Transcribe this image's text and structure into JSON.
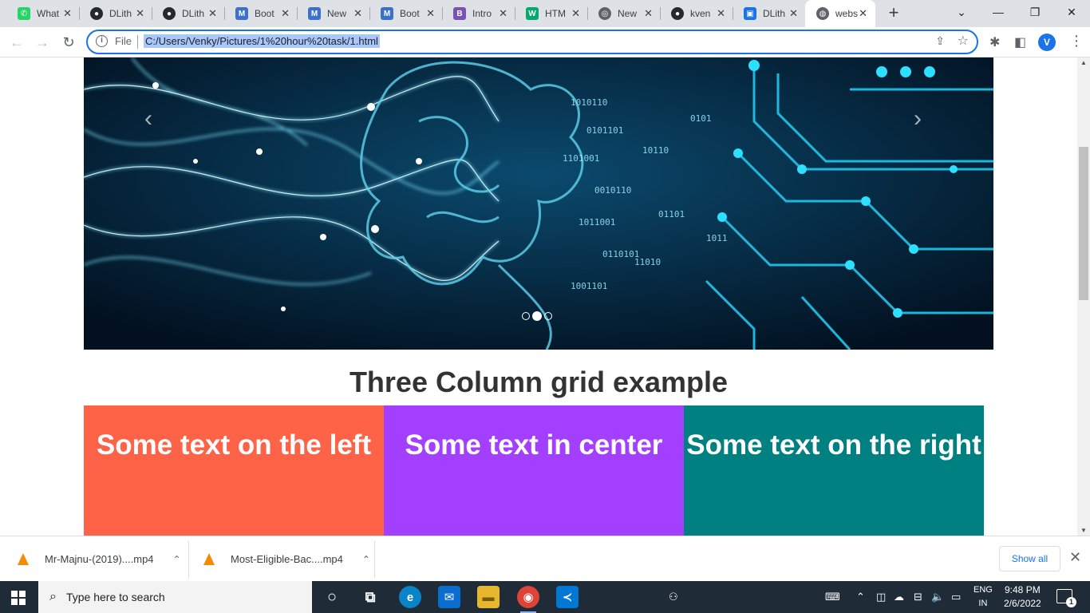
{
  "browser": {
    "tabs": [
      {
        "title": "What",
        "icon": "whatsapp-icon",
        "color": "#25d366",
        "glyph": "✆"
      },
      {
        "title": "DLith",
        "icon": "github-icon",
        "color": "#24292e",
        "glyph": "●"
      },
      {
        "title": "DLith",
        "icon": "github-icon",
        "color": "#24292e",
        "glyph": "●"
      },
      {
        "title": "Boot",
        "icon": "mdb-icon",
        "color": "#3b71ca",
        "glyph": "M"
      },
      {
        "title": "New",
        "icon": "mdb-icon",
        "color": "#3b71ca",
        "glyph": "M"
      },
      {
        "title": "Boot",
        "icon": "mdb-icon",
        "color": "#3b71ca",
        "glyph": "M"
      },
      {
        "title": "Intro",
        "icon": "bootstrap-icon",
        "color": "#7952b3",
        "glyph": "B"
      },
      {
        "title": "HTM",
        "icon": "w3schools-icon",
        "color": "#04aa6d",
        "glyph": "W"
      },
      {
        "title": "New",
        "icon": "chrome-icon",
        "color": "#5f6368",
        "glyph": "◎"
      },
      {
        "title": "kven",
        "icon": "github-icon",
        "color": "#24292e",
        "glyph": "●"
      },
      {
        "title": "DLith",
        "icon": "contacts-icon",
        "color": "#1a73e8",
        "glyph": "▣"
      },
      {
        "title": "webs",
        "icon": "globe-icon",
        "color": "#5f6368",
        "glyph": "◍"
      }
    ],
    "close_glyph": "✕",
    "new_tab_glyph": "+",
    "tab_search_glyph": "⌄",
    "minimize_glyph": "—",
    "restore_glyph": "❐",
    "window_close_glyph": "✕",
    "back_glyph": "←",
    "forward_glyph": "→",
    "reload_glyph": "↻",
    "info_glyph": "i",
    "scheme_label": "File",
    "url": "C:/Users/Venky/Pictures/1%20hour%20task/1.html",
    "share_glyph": "⇪",
    "star_glyph": "☆",
    "extensions_glyph": "✱",
    "sidepanel_glyph": "◧",
    "profile_initial": "V",
    "menu_glyph": "⋮"
  },
  "page": {
    "carousel": {
      "prev_glyph": "‹",
      "next_glyph": "›",
      "indicator_count": 3,
      "active_index": 1
    },
    "heading": "Three Column grid example",
    "columns": [
      {
        "text": "Some text on the left",
        "color": "#ff6347"
      },
      {
        "text": "Some text in center",
        "color": "#a340ff"
      },
      {
        "text": "Some text on the right",
        "color": "#008080"
      }
    ]
  },
  "scrollbar": {
    "up_glyph": "▲",
    "down_glyph": "▼"
  },
  "downloads": {
    "items": [
      {
        "name": "Mr-Majnu-(2019)....mp4",
        "icon": "vlc-icon"
      },
      {
        "name": "Most-Eligible-Bac....mp4",
        "icon": "vlc-icon"
      }
    ],
    "chevron_glyph": "⌃",
    "show_all": "Show all",
    "close_glyph": "✕"
  },
  "taskbar": {
    "search_placeholder": "Type here to search",
    "search_glyph": "⌕",
    "apps": [
      {
        "name": "cortana-icon",
        "glyph": "○",
        "color": "transparent"
      },
      {
        "name": "task-view-icon",
        "glyph": "⧉",
        "color": "transparent"
      },
      {
        "name": "edge-icon",
        "glyph": "e",
        "color": "#0a84c8"
      },
      {
        "name": "mail-icon",
        "glyph": "✉",
        "color": "#0a6ed1"
      },
      {
        "name": "file-explorer-icon",
        "glyph": "▬",
        "color": "#e8b730"
      },
      {
        "name": "chrome-icon",
        "glyph": "◉",
        "color": "#db4437"
      },
      {
        "name": "vscode-icon",
        "glyph": "≺",
        "color": "#0078d4"
      }
    ],
    "people_glyph": "⚇",
    "tray": [
      {
        "name": "keyboard-tray-icon",
        "glyph": "⌨"
      },
      {
        "name": "chevron-up-tray-icon",
        "glyph": "⌃"
      },
      {
        "name": "meet-now-icon",
        "glyph": "◫"
      },
      {
        "name": "onedrive-icon",
        "glyph": "☁"
      },
      {
        "name": "network-icon",
        "glyph": "⊟"
      },
      {
        "name": "volume-icon",
        "glyph": "🔈"
      },
      {
        "name": "battery-icon",
        "glyph": "▭"
      }
    ],
    "lang_top": "ENG",
    "lang_bottom": "IN",
    "time": "9:48 PM",
    "date": "2/6/2022",
    "notification_count": "1"
  }
}
